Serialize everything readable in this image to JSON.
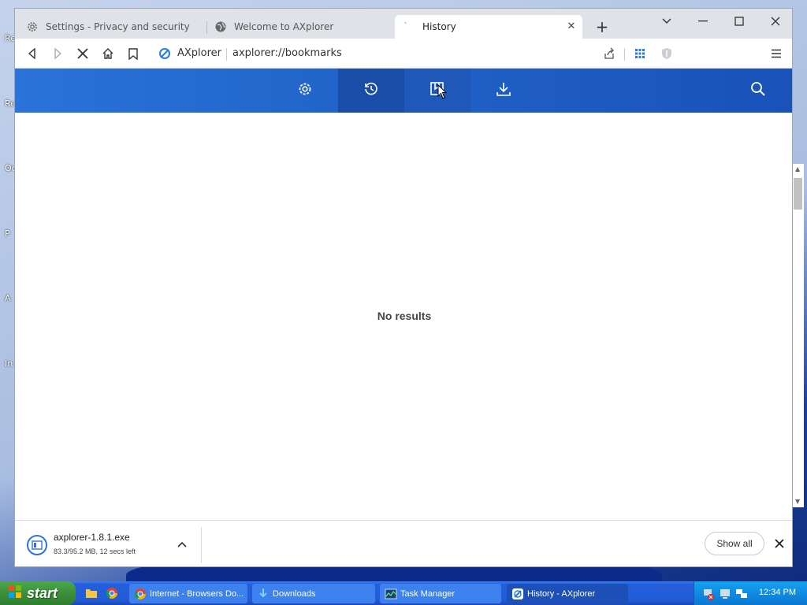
{
  "desktop": {
    "labels": [
      "Re",
      "Re",
      "Oc",
      "P",
      "A",
      "In"
    ]
  },
  "browser": {
    "tabs": [
      {
        "label": "Settings - Privacy and security",
        "icon": "gear-icon",
        "active": false
      },
      {
        "label": "Welcome to AXplorer",
        "icon": "globe-icon",
        "active": false
      },
      {
        "label": "History",
        "icon": "loading-icon",
        "active": true
      }
    ],
    "toolbar": {
      "site_name": "AXplorer",
      "url": "axplorer://bookmarks"
    },
    "app_nav": [
      {
        "name": "settings",
        "icon": "gear-icon"
      },
      {
        "name": "history",
        "icon": "history-icon"
      },
      {
        "name": "bookmarks",
        "icon": "bookmarks-icon"
      },
      {
        "name": "downloads",
        "icon": "download-icon"
      }
    ],
    "content": {
      "empty_message": "No results"
    },
    "download_bar": {
      "file_name": "axplorer-1.8.1.exe",
      "status": "83.3/95.2 MB, 12 secs left",
      "show_all_label": "Show all"
    }
  },
  "taskbar": {
    "start_label": "start",
    "tasks": [
      {
        "label": "Internet - Browsers Do...",
        "icon": "chrome-icon",
        "active": false
      },
      {
        "label": "Downloads",
        "icon": "download-icon",
        "active": false
      },
      {
        "label": "Task Manager",
        "icon": "task-manager-icon",
        "active": false
      },
      {
        "label": "History - AXplorer",
        "icon": "axplorer-icon",
        "active": true
      }
    ],
    "clock": "12:34 PM"
  },
  "colors": {
    "header_blue": "#2163c8",
    "selected_nav": "#1a4da8",
    "taskbar_blue": "#245edb",
    "start_green": "#3c8f3c"
  }
}
